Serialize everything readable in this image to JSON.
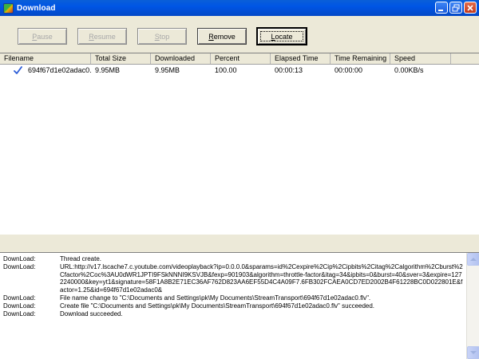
{
  "window": {
    "title": "Download"
  },
  "toolbar": {
    "pause_label": "Pause",
    "resume_label": "Resume",
    "stop_label": "Stop",
    "remove_label": "Remove",
    "locate_label": "Locate"
  },
  "list": {
    "columns": [
      "Filename",
      "Total Size",
      "Downloaded",
      "Percent",
      "Elapsed Time",
      "Time Remaining",
      "Speed"
    ],
    "rows": [
      {
        "status_icon": "check-icon",
        "filename": "694f67d1e02adac0...",
        "total_size": "9.95MB",
        "downloaded": "9.95MB",
        "percent": "100.00",
        "elapsed": "00:00:13",
        "remaining": "00:00:00",
        "speed": "0.00KB/s"
      }
    ]
  },
  "log": [
    {
      "source": "DownLoad:",
      "message": "Thread create."
    },
    {
      "source": "DownLoad:",
      "message": "URL:http://v17.lscache7.c.youtube.com/videoplayback?ip=0.0.0.0&sparams=id%2Cexpire%2Cip%2Cipbits%2Citag%2Calgorithm%2Cburst%2Cfactor%2Coc%3AU0dWR1JPTI9FSkNNNI9KSVJB&fexp=901903&algorithm=throttle-factor&itag=34&ipbits=0&burst=40&sver=3&expire=1272240000&key=yt1&signature=58F1A8B2E71EC36AF762D823AA6EF55D4C4A09F7.6FB302FCAEA0CD7ED2002B4F61228BC0D022801E&factor=1.25&id=694f67d1e02adac0&"
    },
    {
      "source": "DownLoad:",
      "message": "File name change to \"C:\\Documents and Settings\\pk\\My Documents\\StreamTransport\\694f67d1e02adac0.flv\"."
    },
    {
      "source": "DownLoad:",
      "message": "Create file \"C:\\Documents and Settings\\pk\\My Documents\\StreamTransport\\694f67d1e02adac0.flv\" succeeded."
    },
    {
      "source": "DownLoad:",
      "message": "Download succeeded."
    }
  ],
  "colors": {
    "titlebar": "#0055e5",
    "window_bg": "#ece9d8",
    "check": "#2a5bd7"
  }
}
